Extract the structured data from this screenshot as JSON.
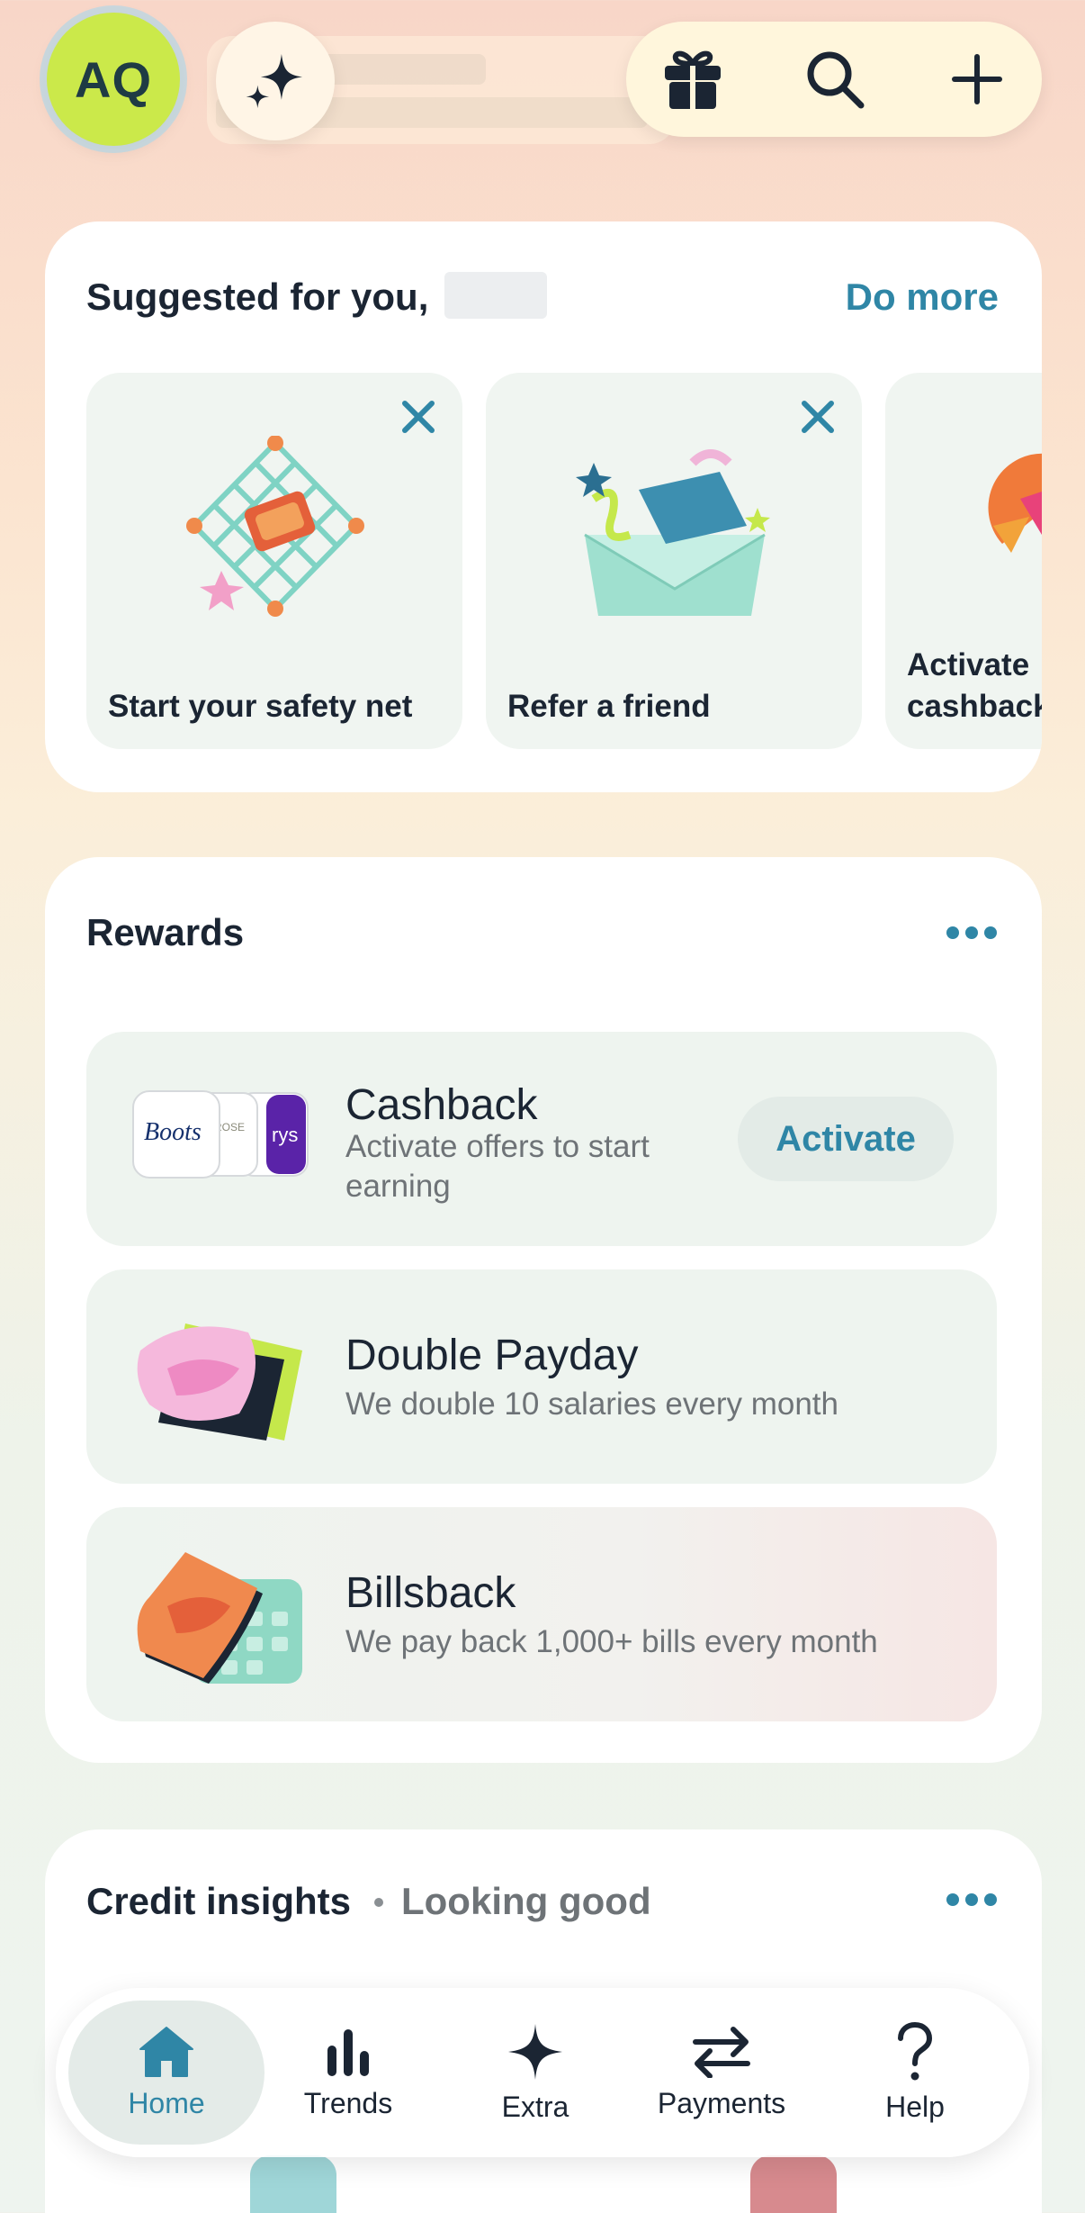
{
  "header": {
    "avatar_initials": "AQ",
    "icons": [
      "sparkle-icon",
      "gift-icon",
      "search-icon",
      "plus-icon"
    ]
  },
  "suggested": {
    "title": "Suggested for you,",
    "do_more": "Do more",
    "tiles": [
      {
        "label": "Start your safety net"
      },
      {
        "label": "Refer a friend"
      },
      {
        "label": "Activate cashback"
      }
    ]
  },
  "rewards": {
    "title": "Rewards",
    "items": [
      {
        "title": "Cashback",
        "subtitle": "Activate offers to start earning",
        "action": "Activate",
        "logos": [
          "Boots",
          "ROSE",
          "rys"
        ]
      },
      {
        "title": "Double Payday",
        "subtitle": "We double 10 salaries every month"
      },
      {
        "title": "Billsback",
        "subtitle": "We pay back 1,000+ bills every month"
      }
    ]
  },
  "credit": {
    "title": "Credit insights",
    "status": "Looking good"
  },
  "nav": {
    "items": [
      {
        "label": "Home",
        "icon": "home-icon",
        "active": true
      },
      {
        "label": "Trends",
        "icon": "bar-chart-icon"
      },
      {
        "label": "Extra",
        "icon": "sparkle-icon"
      },
      {
        "label": "Payments",
        "icon": "transfer-arrows-icon"
      },
      {
        "label": "Help",
        "icon": "question-icon"
      }
    ]
  },
  "colors": {
    "accent": "#2f86a6",
    "avatar_bg": "#cbe94a",
    "text": "#1b2533",
    "muted": "#6e7377",
    "row_bg": "#eef4ef"
  }
}
